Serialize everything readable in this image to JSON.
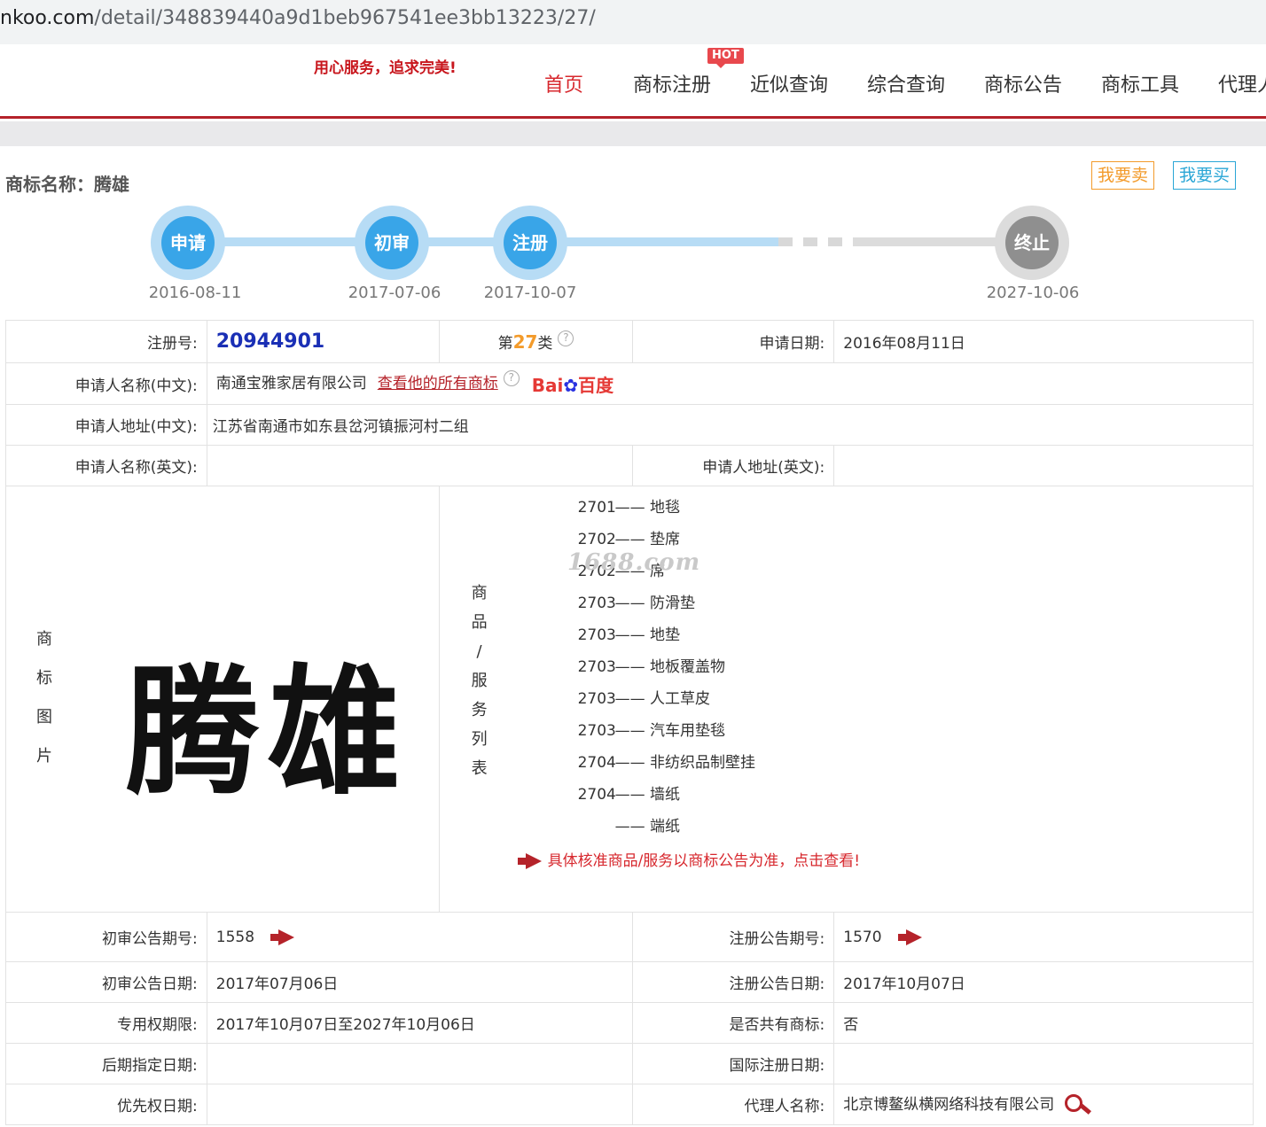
{
  "browser": {
    "url_host": "nkoo.com",
    "url_path": "/detail/348839440a9d1beb967541ee3bb13223/27/"
  },
  "header": {
    "slogan": "用心服务，追求完美!",
    "hot_badge": "HOT",
    "nav": [
      {
        "label": "首页",
        "active": true
      },
      {
        "label": "商标注册",
        "active": false
      },
      {
        "label": "近似查询",
        "active": false
      },
      {
        "label": "综合查询",
        "active": false
      },
      {
        "label": "商标公告",
        "active": false
      },
      {
        "label": "商标工具",
        "active": false
      },
      {
        "label": "代理人",
        "active": false
      }
    ]
  },
  "title": {
    "label": "商标名称：",
    "name": "腾雄",
    "sell_button": "我要卖",
    "buy_button": "我要买"
  },
  "timeline": [
    {
      "step": "申请",
      "date": "2016-08-11"
    },
    {
      "step": "初审",
      "date": "2017-07-06"
    },
    {
      "step": "注册",
      "date": "2017-10-07"
    },
    {
      "step": "终止",
      "date": "2027-10-06"
    }
  ],
  "info": {
    "reg_no_label": "注册号:",
    "reg_no": "20944901",
    "class_prefix": "第",
    "class_num": "27",
    "class_suffix": "类",
    "apply_date_label": "申请日期:",
    "apply_date": "2016年08月11日",
    "applicant_cn_label": "申请人名称(中文):",
    "applicant_cn": "南通宝雅家居有限公司",
    "view_all_link": "查看他的所有商标",
    "baidu_logo": "Bai百度",
    "address_cn_label": "申请人地址(中文):",
    "address_cn": "江苏省南通市如东县岔河镇振河村二组",
    "applicant_en_label": "申请人名称(英文):",
    "applicant_en": "",
    "address_en_label": "申请人地址(英文):",
    "address_en": "",
    "image_label_chars": [
      "商",
      "标",
      "图",
      "片"
    ],
    "image_text": "腾雄",
    "goods_label_chars": [
      "商",
      "品",
      "/",
      "服",
      "务",
      "列",
      "表"
    ],
    "goods": [
      {
        "code": "2701",
        "name": "地毯"
      },
      {
        "code": "2702",
        "name": "垫席"
      },
      {
        "code": "2702",
        "name": "席"
      },
      {
        "code": "2703",
        "name": "防滑垫"
      },
      {
        "code": "2703",
        "name": "地垫"
      },
      {
        "code": "2703",
        "name": "地板覆盖物"
      },
      {
        "code": "2703",
        "name": "人工草皮"
      },
      {
        "code": "2703",
        "name": "汽车用垫毯"
      },
      {
        "code": "2704",
        "name": "非纺织品制壁挂"
      },
      {
        "code": "2704",
        "name": "墙纸"
      },
      {
        "code": "",
        "name": "端纸"
      }
    ],
    "goods_dash": "——",
    "goods_notice": "具体核准商品/服务以商标公告为准，点击查看!",
    "watermark": "1688.com",
    "prelim_no_label": "初审公告期号:",
    "prelim_no": "1558",
    "reg_pub_no_label": "注册公告期号:",
    "reg_pub_no": "1570",
    "prelim_date_label": "初审公告日期:",
    "prelim_date": "2017年07月06日",
    "reg_pub_date_label": "注册公告日期:",
    "reg_pub_date": "2017年10月07日",
    "exclusive_label": "专用权期限:",
    "exclusive": "2017年10月07日至2027年10月06日",
    "shared_label": "是否共有商标:",
    "shared": "否",
    "later_date_label": "后期指定日期:",
    "later_date": "",
    "intl_date_label": "国际注册日期:",
    "intl_date": "",
    "priority_label": "优先权日期:",
    "priority": "",
    "agent_label": "代理人名称:",
    "agent": "北京博鳌纵横网络科技有限公司"
  },
  "colors": {
    "brand_red": "#b5232a",
    "nav_active": "#d7282e",
    "timeline_blue": "#39a5e8",
    "sell_orange": "#f39b2b",
    "buy_blue": "#2aa6d6",
    "reg_no_blue": "#1a2fb5"
  }
}
